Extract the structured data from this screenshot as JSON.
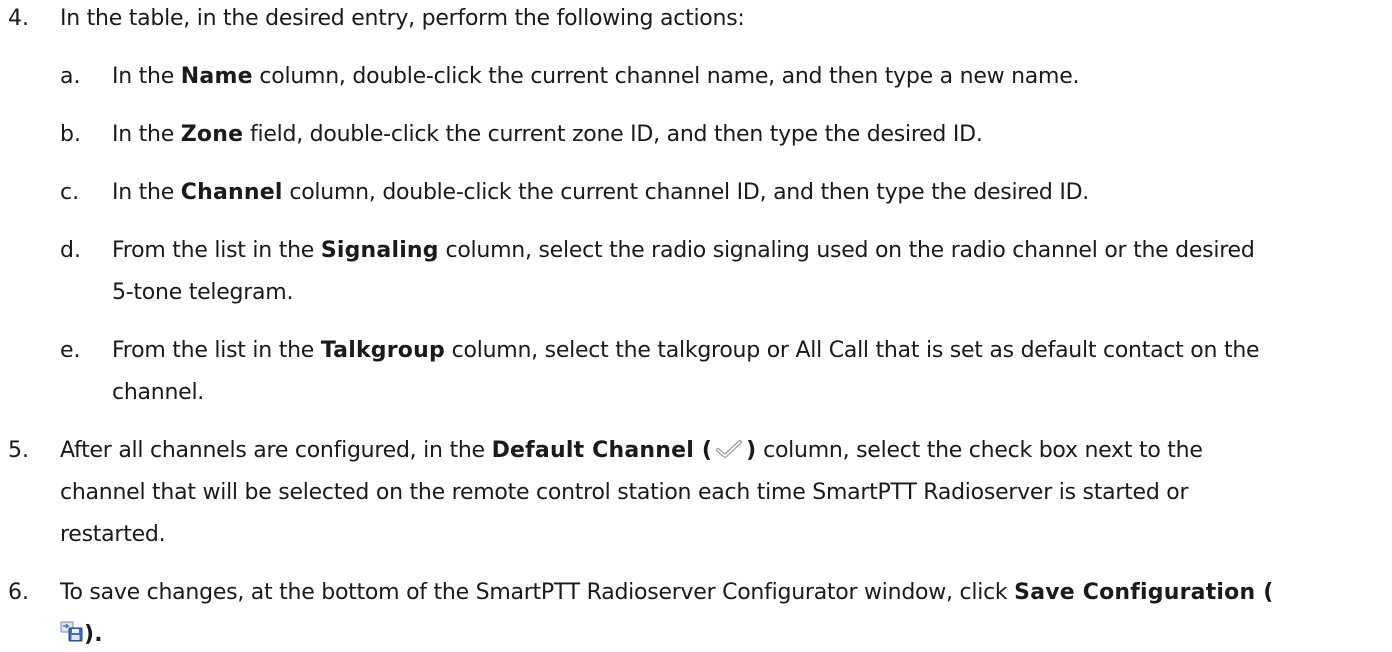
{
  "steps": [
    {
      "num": "4.",
      "line1": "In the table, in the desired entry, perform the following actions:"
    },
    {
      "num": "5.",
      "pre": "After all channels are configured, in the ",
      "bold": "Default Channel (",
      "bold_close": ")",
      "post": " column, select the check box next to the",
      "line2": "channel that will be selected on the remote control station each time SmartPTT Radioserver is started or",
      "line3": "restarted."
    },
    {
      "num": "6.",
      "pre": "To save changes, at the bottom of the SmartPTT Radioserver Configurator window, click ",
      "bold": "Save Configuration (",
      "bold_close": ")."
    }
  ],
  "substeps": [
    {
      "letter": "a.",
      "pre": "In the ",
      "bold": "Name",
      "post": " column, double-click the current channel name, and then type a new name."
    },
    {
      "letter": "b.",
      "pre": "In the ",
      "bold": "Zone",
      "post": " field, double-click the current zone ID, and then type the desired ID."
    },
    {
      "letter": "c.",
      "pre": "In the ",
      "bold": "Channel",
      "post": " column, double-click the current channel ID, and then type the desired ID."
    },
    {
      "letter": "d.",
      "pre": "From the list in the ",
      "bold": "Signaling",
      "post": " column, select the radio signaling used on the radio channel or the desired",
      "line2": "5-tone telegram."
    },
    {
      "letter": "e.",
      "pre": "From the list in the ",
      "bold": "Talkgroup",
      "post": " column, select the talkgroup or All Call that is set as default contact on the",
      "line2": "channel."
    }
  ],
  "icons": {
    "default_channel": "check-mark-icon",
    "save": "save-configuration-icon"
  }
}
